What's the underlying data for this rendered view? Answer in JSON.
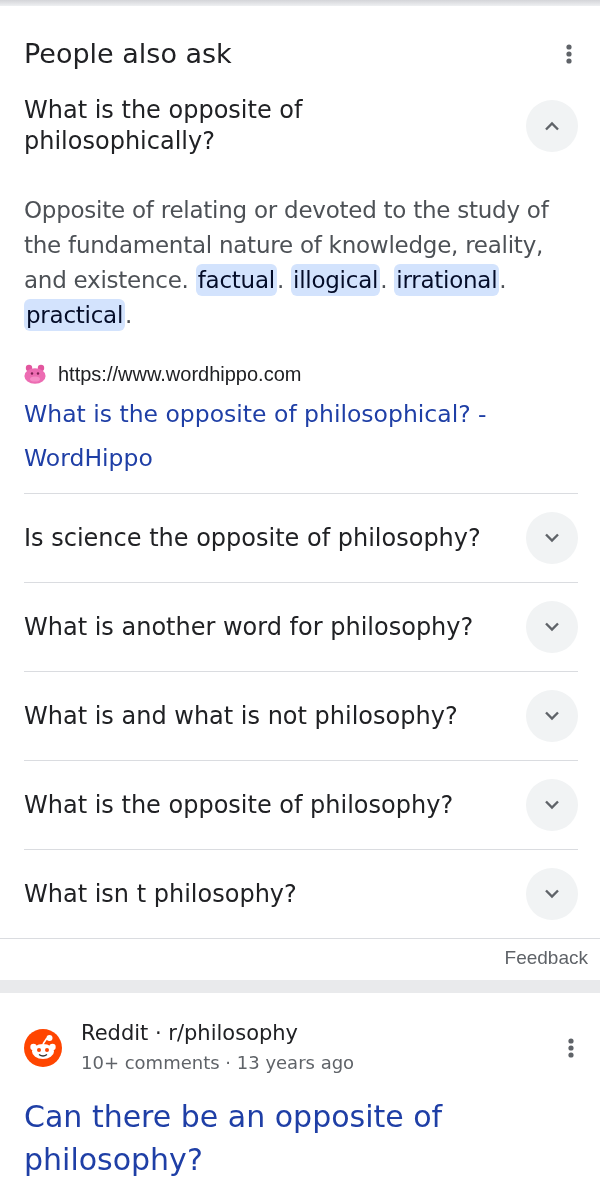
{
  "people_also_ask": {
    "title": "People also ask",
    "questions": [
      {
        "text": "What is the opposite of philosophically?",
        "expanded": true,
        "answer": {
          "text": "Opposite of relating or devoted to the study of the fundamental nature of knowledge, reality, and existence.",
          "synonyms": [
            {
              "word": "factual",
              "punctuation": "."
            },
            {
              "word": "illogical",
              "punctuation": "."
            },
            {
              "word": "irrational",
              "punctuation": "."
            },
            {
              "word": "practical",
              "punctuation": "."
            }
          ],
          "source": {
            "url": "https://www.wordhippo.com",
            "title": "What is the opposite of philosophical? - WordHippo"
          }
        }
      },
      {
        "text": "Is science the opposite of philosophy?",
        "expanded": false
      },
      {
        "text": "What is another word for philosophy?",
        "expanded": false
      },
      {
        "text": "What is and what is not philosophy?",
        "expanded": false
      },
      {
        "text": "What is the opposite of philosophy?",
        "expanded": false
      },
      {
        "text": "What isn t philosophy?",
        "expanded": false
      }
    ],
    "feedback": "Feedback"
  },
  "results": [
    {
      "source": "Reddit · r/philosophy",
      "meta": "10+ comments · 13 years ago",
      "title": "Can there be an opposite of philosophy?"
    }
  ]
}
